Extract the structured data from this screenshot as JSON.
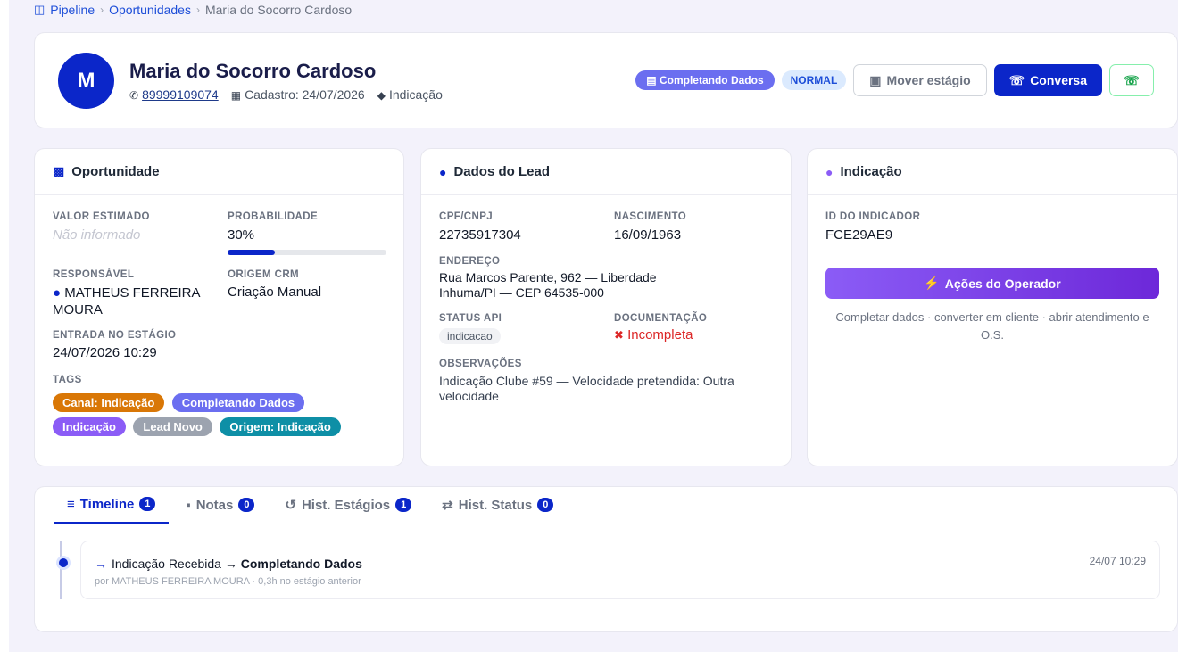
{
  "breadcrumb": {
    "items": [
      "Pipeline",
      "Oportunidades",
      "Maria do Socorro Cardoso"
    ],
    "icon": "board-icon"
  },
  "header": {
    "avatar_letter": "M",
    "name": "Maria do Socorro Cardoso",
    "phone": "89999109074",
    "cadastro": "Cadastro: 24/07/2026",
    "source": "Indicação",
    "stage_badge": "Completando Dados",
    "priority_badge": "NORMAL",
    "move_stage_label": "Mover estágio",
    "conversation_label": "Conversa",
    "colors": {
      "primary": "#0b26c9",
      "stage": "#6b6ef0",
      "whatsapp": "#16a34a"
    }
  },
  "opportunity": {
    "title": "Oportunidade",
    "valor_label": "VALOR ESTIMADO",
    "valor_value": "Não informado",
    "prob_label": "PROBABILIDADE",
    "prob_value": "30%",
    "prob_fraction": 0.3,
    "resp_label": "RESPONSÁVEL",
    "resp_value": "MATHEUS FERREIRA MOURA",
    "origem_label": "ORIGEM CRM",
    "origem_value": "Criação Manual",
    "entrada_label": "ENTRADA NO ESTÁGIO",
    "entrada_value": "24/07/2026 10:29",
    "tags_label": "TAGS",
    "tags": [
      {
        "label": "Canal: Indicação",
        "color": "#d97706"
      },
      {
        "label": "Completando Dados",
        "color": "#6b6ef0"
      },
      {
        "label": "Indicação",
        "color": "#8b5cf6"
      },
      {
        "label": "Lead Novo",
        "color": "#9ca3af"
      },
      {
        "label": "Origem: Indicação",
        "color": "#0e8fa6"
      }
    ]
  },
  "lead": {
    "title": "Dados do Lead",
    "cpf_label": "CPF/CNPJ",
    "cpf_value": "22735917304",
    "nasc_label": "NASCIMENTO",
    "nasc_value": "16/09/1963",
    "end_label": "ENDEREÇO",
    "end_line1": "Rua Marcos Parente, 962 — Liberdade",
    "end_line2": "Inhuma/PI — CEP 64535-000",
    "status_label": "STATUS API",
    "status_value": "indicacao",
    "doc_label": "DOCUMENTAÇÃO",
    "doc_value": "Incompleta",
    "obs_label": "OBSERVAÇÕES",
    "obs_value": "Indicação Clube #59 — Velocidade pretendida: Outra velocidade"
  },
  "indicacao": {
    "title": "Indicação",
    "id_label": "ID DO INDICADOR",
    "id_value": "FCE29AE9",
    "action_label": "Ações do Operador",
    "action_hint": "Completar dados · converter em cliente · abrir atendimento e O.S."
  },
  "tabs": [
    {
      "label": "Timeline",
      "count": "1",
      "icon": "list-icon"
    },
    {
      "label": "Notas",
      "count": "0",
      "icon": "note-icon"
    },
    {
      "label": "Hist. Estágios",
      "count": "1",
      "icon": "history-icon"
    },
    {
      "label": "Hist. Status",
      "count": "0",
      "icon": "swap-icon"
    }
  ],
  "timeline": {
    "from": "Indicação Recebida",
    "to": "Completando Dados",
    "subtitle": "por MATHEUS FERREIRA MOURA  · 0,3h no estágio anterior",
    "time": "24/07 10:29"
  }
}
